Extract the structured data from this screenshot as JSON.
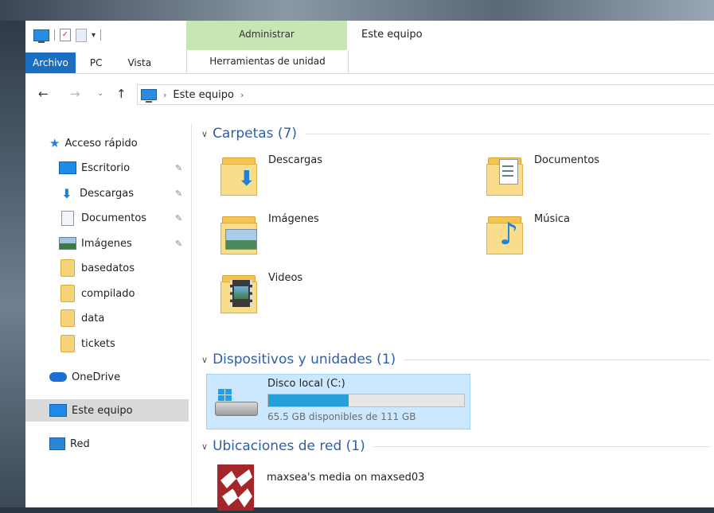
{
  "window": {
    "title": "Este equipo"
  },
  "ribbon": {
    "context_group": "Administrar",
    "context_tab": "Herramientas de unidad",
    "tabs": [
      {
        "label": "Archivo"
      },
      {
        "label": "PC"
      },
      {
        "label": "Vista"
      }
    ]
  },
  "address": {
    "crumb": "Este equipo"
  },
  "sidebar": {
    "quick_access": "Acceso rápido",
    "items": [
      {
        "label": "Escritorio",
        "icon": "desktop-icon",
        "pinned": true
      },
      {
        "label": "Descargas",
        "icon": "download-arrow-icon",
        "pinned": true
      },
      {
        "label": "Documentos",
        "icon": "documents-icon",
        "pinned": true
      },
      {
        "label": "Imágenes",
        "icon": "pictures-icon",
        "pinned": true
      },
      {
        "label": "basedatos",
        "icon": "folder-icon",
        "pinned": false
      },
      {
        "label": "compilado",
        "icon": "folder-icon",
        "pinned": false
      },
      {
        "label": "data",
        "icon": "folder-icon",
        "pinned": false
      },
      {
        "label": "tickets",
        "icon": "folder-icon",
        "pinned": false
      }
    ],
    "onedrive": "OneDrive",
    "this_pc": "Este equipo",
    "network": "Red"
  },
  "content": {
    "folders_header": "Carpetas (7)",
    "folders": [
      {
        "name": "Descargas"
      },
      {
        "name": "Documentos"
      },
      {
        "name": "Imágenes"
      },
      {
        "name": "Música"
      },
      {
        "name": "Videos"
      }
    ],
    "devices_header": "Dispositivos y unidades (1)",
    "drive": {
      "name": "Disco local (C:)",
      "free_text": "65.5 GB disponibles de 111 GB",
      "used_fraction": 0.41,
      "bar_color": "#26a0da"
    },
    "network_header": "Ubicaciones de red (1)",
    "network_item": {
      "name": "maxsea's media on maxsed03"
    }
  },
  "colors": {
    "file_tab": "#1a6fc2",
    "context_tab": "#c8e6b4",
    "group_header": "#2d5fa8",
    "selection": "#cce8ff"
  }
}
